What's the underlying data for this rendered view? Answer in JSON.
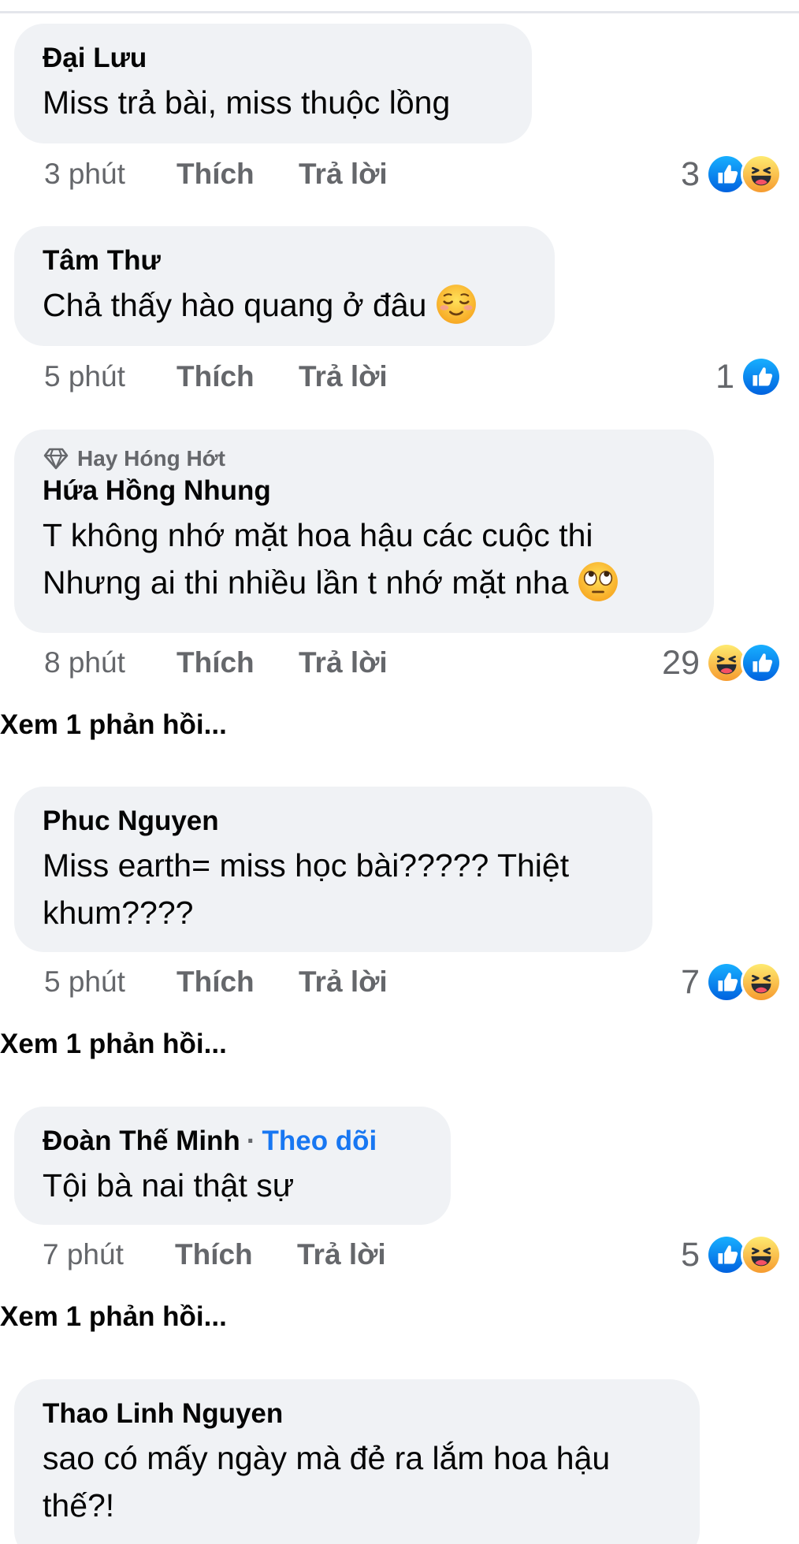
{
  "comments": [
    {
      "author": "Đại Lưu",
      "lines": [
        "Miss trả bài, miss thuộc lồng"
      ],
      "time": "3 phút",
      "like_label": "Thích",
      "reply_label": "Trả lời",
      "reaction_count": "3",
      "reactions": [
        "like-icon",
        "haha-icon"
      ]
    },
    {
      "author": "Tâm Thư",
      "lines": [
        "Chả thấy hào quang ở đâu"
      ],
      "inline_emoji": "relieved-face-emoji",
      "time": "5 phút",
      "like_label": "Thích",
      "reply_label": "Trả lời",
      "reaction_count": "1",
      "reactions": [
        "like-icon"
      ]
    },
    {
      "badge": "Hay Hóng Hớt",
      "badge_icon": "diamond-icon",
      "author": "Hứa Hồng Nhung",
      "lines": [
        "T không nhớ mặt hoa hậu các cuộc thi",
        "Nhưng ai thi nhiều lần t nhớ mặt nha"
      ],
      "inline_emoji": "eye-roll-face-emoji",
      "time": "8 phút",
      "like_label": "Thích",
      "reply_label": "Trả lời",
      "reaction_count": "29",
      "reactions": [
        "haha-icon",
        "like-icon"
      ],
      "view_replies": "Xem 1 phản hồi..."
    },
    {
      "author": "Phuc Nguyen",
      "lines": [
        "Miss earth= miss học bài????? Thiệt",
        "khum????"
      ],
      "time": "5 phút",
      "like_label": "Thích",
      "reply_label": "Trả lời",
      "reaction_count": "7",
      "reactions": [
        "like-icon",
        "haha-icon"
      ],
      "view_replies": "Xem 1 phản hồi..."
    },
    {
      "author": "Đoàn Thế Minh",
      "follow_label": "Theo dõi",
      "lines": [
        "Tội bà nai thật sự"
      ],
      "time": "7 phút",
      "like_label": "Thích",
      "reply_label": "Trả lời",
      "reaction_count": "5",
      "reactions": [
        "like-icon",
        "haha-icon"
      ],
      "view_replies": "Xem 1 phản hồi..."
    },
    {
      "author": "Thao Linh Nguyen",
      "lines": [
        "sao có mấy ngày mà đẻ ra lắm hoa hậu",
        "thế?!"
      ]
    }
  ],
  "colors": {
    "bubble": "#f0f2f5",
    "meta_text": "#65676b",
    "follow_blue": "#1877f2",
    "like_blue": "#1877f2",
    "haha_yellow": "#f7b125"
  }
}
